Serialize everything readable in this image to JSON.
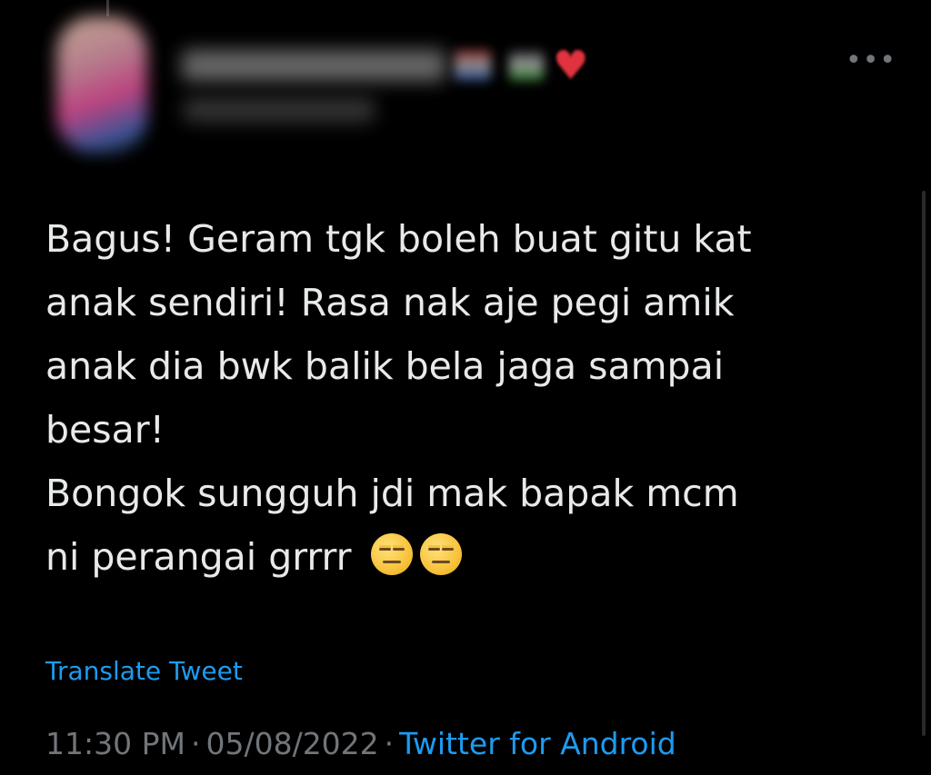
{
  "author": {
    "avatar_icon": "profile-avatar-blurred",
    "display_name_redacted": true,
    "handle_redacted": true,
    "name_emoji_icons": [
      "flag-icon",
      "flag-icon",
      "red-heart-icon"
    ]
  },
  "more_icon": "more-options-icon",
  "tweet": {
    "lines": [
      "Bagus! Geram tgk boleh buat gitu kat",
      "anak sendiri! Rasa nak aje pegi amik",
      "anak dia bwk balik bela jaga sampai",
      "besar!",
      "Bongok sungguh jdi mak bapak mcm",
      "ni perangai grrrr"
    ],
    "trailing_emoji": [
      "expressionless-face-icon",
      "expressionless-face-icon"
    ]
  },
  "translate_label": "Translate Tweet",
  "meta": {
    "time": "11:30 PM",
    "separator": "·",
    "date": "05/08/2022",
    "source": "Twitter for Android"
  },
  "colors": {
    "background": "#000000",
    "text": "#e7e9ea",
    "muted": "#71767b",
    "link": "#1d9bf0",
    "heart": "#e0333f"
  }
}
